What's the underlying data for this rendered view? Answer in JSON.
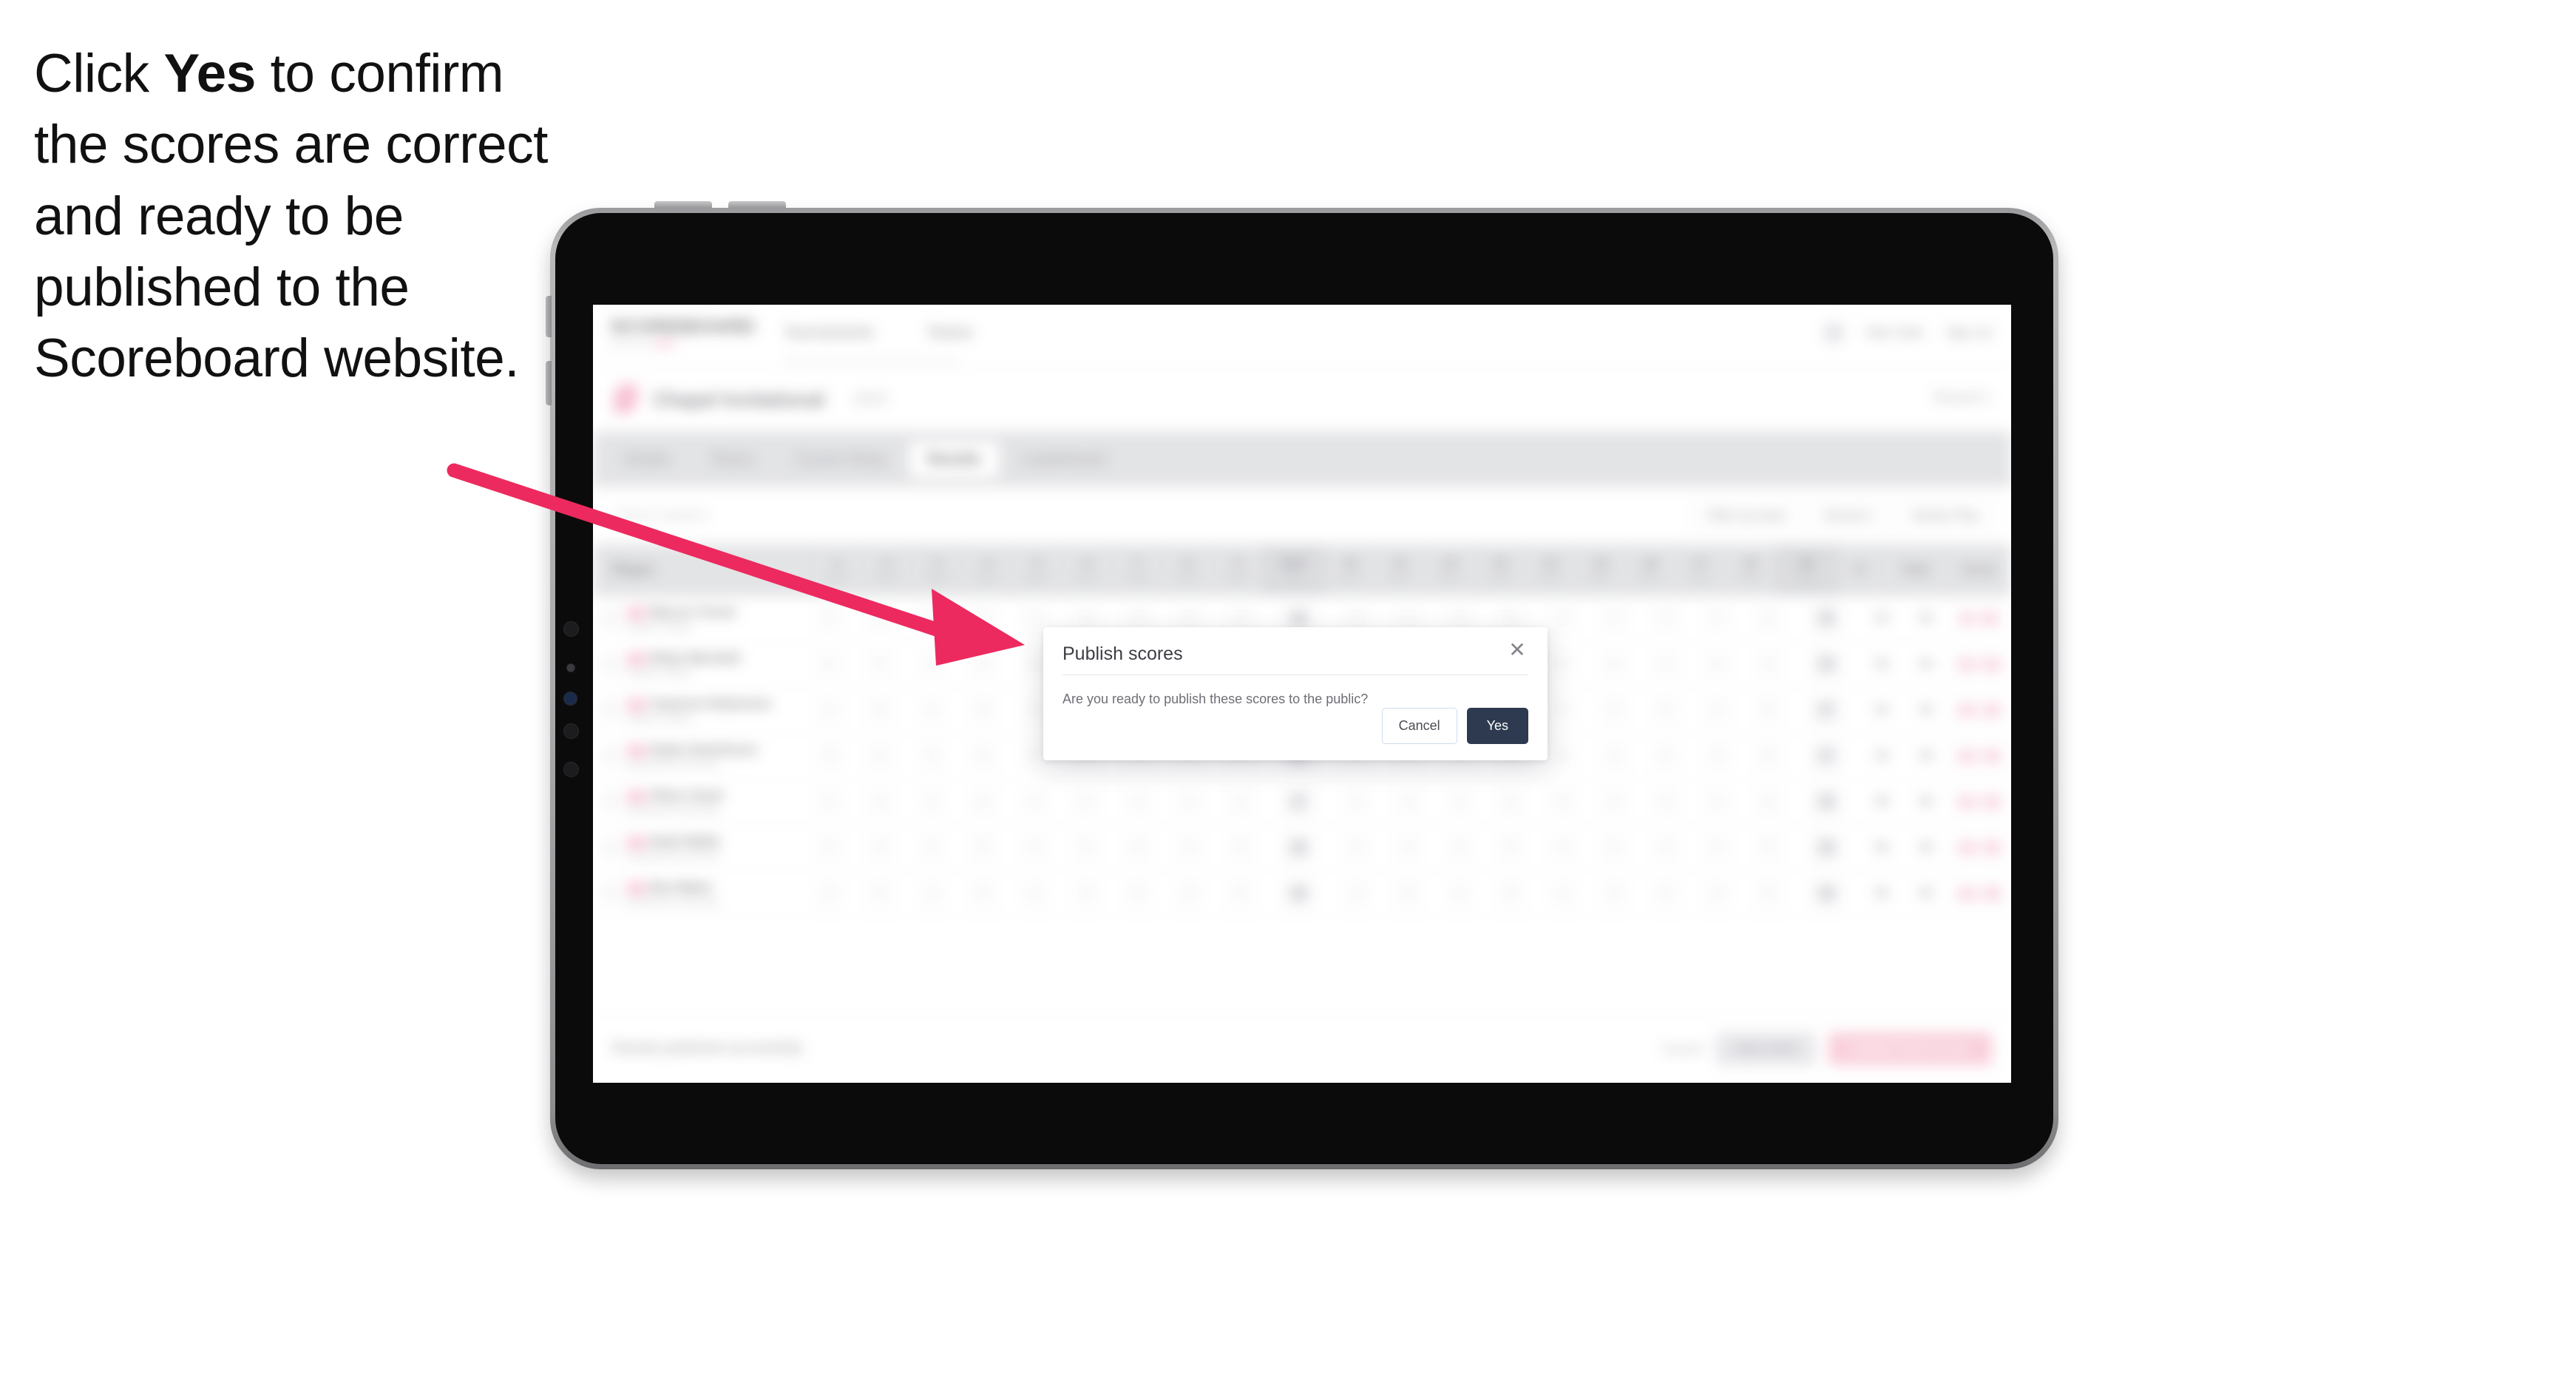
{
  "caption": {
    "before": "Click ",
    "emphasis": "Yes",
    "after": " to confirm the scores are correct and ready to be published to the Scoreboard website."
  },
  "colors": {
    "arrow": "#ec2a5f",
    "accent_pink": "#ec1f63",
    "primary_dark": "#2d3a4f"
  },
  "app": {
    "brand": {
      "word": "SCOREBOARD",
      "sub_prefix": "powered by ",
      "sub_brand": "GOLF"
    },
    "nav_links": [
      "Tournaments",
      "Teams"
    ],
    "nav_right": {
      "notifications_label": "Nick Clark",
      "account_label": "Sign out"
    },
    "tournament": {
      "name": "Chapel Invitational",
      "year": "2022",
      "right_label": "Round 1"
    },
    "tabs": [
      {
        "label": "Details",
        "active": false
      },
      {
        "label": "Teams",
        "active": false
      },
      {
        "label": "Course Setup",
        "active": false
      },
      {
        "label": "Results",
        "active": true
      },
      {
        "label": "Leaderboard",
        "active": false
      }
    ],
    "filterbar": {
      "search_placeholder": "Search players",
      "filters": [
        "Filter by team",
        "Round 1",
        "Stroke Play"
      ]
    },
    "table": {
      "player_header": "Player",
      "holes": [
        {
          "num": "1",
          "par": "Par 4"
        },
        {
          "num": "2",
          "par": "Par 4"
        },
        {
          "num": "3",
          "par": "Par 3"
        },
        {
          "num": "4",
          "par": "Par 5"
        },
        {
          "num": "5",
          "par": "Par 4"
        },
        {
          "num": "6",
          "par": "Par 4"
        },
        {
          "num": "7",
          "par": "Par 3"
        },
        {
          "num": "8",
          "par": "Par 4"
        },
        {
          "num": "9",
          "par": "Par 5"
        },
        {
          "num": "OUT",
          "par": "36"
        },
        {
          "num": "10",
          "par": "Par 4"
        },
        {
          "num": "11",
          "par": "Par 4"
        },
        {
          "num": "12",
          "par": "Par 3"
        },
        {
          "num": "13",
          "par": "Par 5"
        },
        {
          "num": "14",
          "par": "Par 4"
        },
        {
          "num": "15",
          "par": "Par 4"
        },
        {
          "num": "16",
          "par": "Par 3"
        },
        {
          "num": "17",
          "par": "Par 4"
        },
        {
          "num": "18",
          "par": "Par 5"
        },
        {
          "num": "IN",
          "par": "36"
        }
      ],
      "tail_headers": [
        "R",
        "Total",
        "Score"
      ],
      "rows": [
        {
          "badge": "AM",
          "name": "Marcus Turner",
          "school": "Chapel College",
          "scores": [
            "4",
            "4",
            "3",
            "5",
            "4",
            "4",
            "3",
            "4",
            "5",
            "36",
            "4",
            "4",
            "3",
            "5",
            "4",
            "4",
            "3",
            "4",
            "5",
            "36"
          ],
          "r": "72",
          "total": "72",
          "chips": [
            "E",
            "T1"
          ]
        },
        {
          "badge": "AM",
          "name": "Ethan Marshall",
          "school": "Chapel College",
          "scores": [
            "4",
            "5",
            "3",
            "5",
            "4",
            "4",
            "3",
            "4",
            "5",
            "37",
            "4",
            "4",
            "3",
            "5",
            "4",
            "4",
            "3",
            "4",
            "5",
            "36"
          ],
          "r": "73",
          "total": "73",
          "chips": [
            "+1",
            "T2"
          ]
        },
        {
          "badge": "AM",
          "name": "Cameron Robertson",
          "school": "Chapel College",
          "scores": [
            "4",
            "4",
            "4",
            "5",
            "4",
            "4",
            "3",
            "4",
            "5",
            "37",
            "4",
            "4",
            "3",
            "5",
            "4",
            "5",
            "3",
            "4",
            "5",
            "37"
          ],
          "r": "74",
          "total": "74",
          "chips": [
            "+2",
            "T3"
          ]
        },
        {
          "badge": "AM",
          "name": "Dylan Hutchinson",
          "school": "Southwood University",
          "scores": [
            "4",
            "4",
            "3",
            "5",
            "5",
            "4",
            "3",
            "4",
            "5",
            "37",
            "4",
            "4",
            "4",
            "5",
            "4",
            "4",
            "3",
            "4",
            "5",
            "37"
          ],
          "r": "74",
          "total": "74",
          "chips": [
            "+2",
            "T3"
          ]
        },
        {
          "badge": "AM",
          "name": "Oliver Grant",
          "school": "Southwood University",
          "scores": [
            "4",
            "4",
            "3",
            "5",
            "4",
            "5",
            "3",
            "4",
            "5",
            "37",
            "4",
            "4",
            "3",
            "5",
            "5",
            "4",
            "3",
            "4",
            "5",
            "38"
          ],
          "r": "75",
          "total": "75",
          "chips": [
            "+3",
            "T5"
          ]
        },
        {
          "badge": "AM",
          "name": "Noah Webb",
          "school": "Southwood University",
          "scores": [
            "4",
            "4",
            "3",
            "5",
            "4",
            "4",
            "4",
            "4",
            "5",
            "38",
            "4",
            "4",
            "3",
            "5",
            "4",
            "4",
            "4",
            "4",
            "5",
            "38"
          ],
          "r": "76",
          "total": "76",
          "chips": [
            "+4",
            "T6"
          ]
        },
        {
          "badge": "AM",
          "name": "Ben Baker",
          "school": "Southwood University",
          "scores": [
            "5",
            "4",
            "3",
            "5",
            "4",
            "4",
            "3",
            "5",
            "5",
            "38",
            "4",
            "5",
            "3",
            "5",
            "4",
            "4",
            "3",
            "4",
            "5",
            "38"
          ],
          "r": "76",
          "total": "76",
          "chips": [
            "+4",
            "T6"
          ]
        }
      ]
    },
    "footer": {
      "note": "Results published successfully",
      "link": "Cancel",
      "secondary_button": "Save draft",
      "primary_button": "Publish final scores"
    }
  },
  "modal": {
    "title": "Publish scores",
    "body": "Are you ready to publish these scores to the public?",
    "close_icon": "close-icon",
    "cancel_label": "Cancel",
    "confirm_label": "Yes"
  }
}
